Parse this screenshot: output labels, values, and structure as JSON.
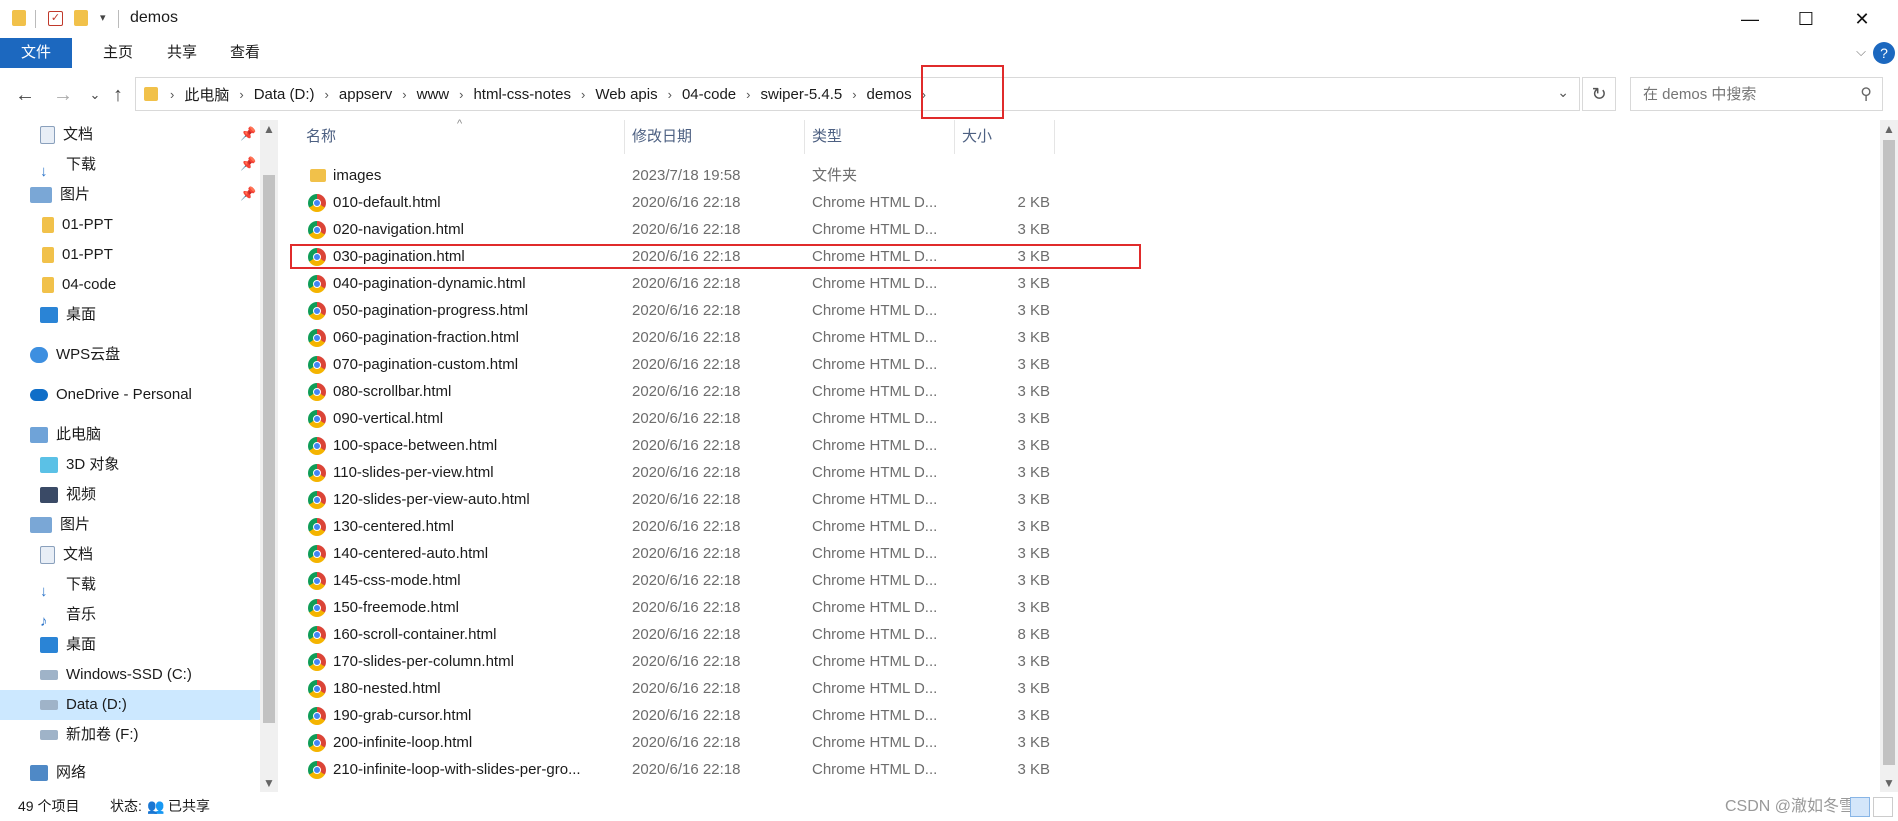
{
  "window": {
    "title": "demos"
  },
  "ribbon": {
    "tabs": [
      "文件",
      "主页",
      "共享",
      "查看"
    ]
  },
  "address": {
    "crumbs": [
      "此电脑",
      "Data (D:)",
      "appserv",
      "www",
      "html-css-notes",
      "Web apis",
      "04-code",
      "swiper-5.4.5",
      "demos"
    ]
  },
  "search": {
    "placeholder": "在 demos 中搜索"
  },
  "nav": {
    "items": [
      {
        "label": "文档",
        "icon": "document-icon",
        "pinned": true
      },
      {
        "label": "下载",
        "icon": "download-icon",
        "pinned": true
      },
      {
        "label": "图片",
        "icon": "pictures-icon",
        "pinned": true
      },
      {
        "label": "01-PPT",
        "icon": "folder-icon"
      },
      {
        "label": "01-PPT",
        "icon": "folder-icon"
      },
      {
        "label": "04-code",
        "icon": "folder-icon"
      },
      {
        "label": "桌面",
        "icon": "desktop-icon"
      },
      {
        "label": "WPS云盘",
        "icon": "cloud-icon"
      },
      {
        "label": "OneDrive - Personal",
        "icon": "onedrive-icon"
      },
      {
        "label": "此电脑",
        "icon": "computer-icon"
      },
      {
        "label": "3D 对象",
        "icon": "3d-objects-icon"
      },
      {
        "label": "视频",
        "icon": "video-icon"
      },
      {
        "label": "图片",
        "icon": "pictures-icon"
      },
      {
        "label": "文档",
        "icon": "document-icon"
      },
      {
        "label": "下载",
        "icon": "download-icon"
      },
      {
        "label": "音乐",
        "icon": "music-icon"
      },
      {
        "label": "桌面",
        "icon": "desktop-icon"
      },
      {
        "label": "Windows-SSD (C:)",
        "icon": "drive-icon"
      },
      {
        "label": "Data (D:)",
        "icon": "drive-icon",
        "selected": true
      },
      {
        "label": "新加卷 (F:)",
        "icon": "drive-icon"
      },
      {
        "label": "网络",
        "icon": "network-icon"
      }
    ]
  },
  "columns": {
    "name": "名称",
    "date": "修改日期",
    "type": "类型",
    "size": "大小"
  },
  "files": [
    {
      "name": "images",
      "date": "2023/7/18 19:58",
      "type": "文件夹",
      "size": "",
      "kind": "folder"
    },
    {
      "name": "010-default.html",
      "date": "2020/6/16 22:18",
      "type": "Chrome HTML D...",
      "size": "2 KB",
      "kind": "chrome"
    },
    {
      "name": "020-navigation.html",
      "date": "2020/6/16 22:18",
      "type": "Chrome HTML D...",
      "size": "3 KB",
      "kind": "chrome"
    },
    {
      "name": "030-pagination.html",
      "date": "2020/6/16 22:18",
      "type": "Chrome HTML D...",
      "size": "3 KB",
      "kind": "chrome",
      "highlighted": true
    },
    {
      "name": "040-pagination-dynamic.html",
      "date": "2020/6/16 22:18",
      "type": "Chrome HTML D...",
      "size": "3 KB",
      "kind": "chrome"
    },
    {
      "name": "050-pagination-progress.html",
      "date": "2020/6/16 22:18",
      "type": "Chrome HTML D...",
      "size": "3 KB",
      "kind": "chrome"
    },
    {
      "name": "060-pagination-fraction.html",
      "date": "2020/6/16 22:18",
      "type": "Chrome HTML D...",
      "size": "3 KB",
      "kind": "chrome"
    },
    {
      "name": "070-pagination-custom.html",
      "date": "2020/6/16 22:18",
      "type": "Chrome HTML D...",
      "size": "3 KB",
      "kind": "chrome"
    },
    {
      "name": "080-scrollbar.html",
      "date": "2020/6/16 22:18",
      "type": "Chrome HTML D...",
      "size": "3 KB",
      "kind": "chrome"
    },
    {
      "name": "090-vertical.html",
      "date": "2020/6/16 22:18",
      "type": "Chrome HTML D...",
      "size": "3 KB",
      "kind": "chrome"
    },
    {
      "name": "100-space-between.html",
      "date": "2020/6/16 22:18",
      "type": "Chrome HTML D...",
      "size": "3 KB",
      "kind": "chrome"
    },
    {
      "name": "110-slides-per-view.html",
      "date": "2020/6/16 22:18",
      "type": "Chrome HTML D...",
      "size": "3 KB",
      "kind": "chrome"
    },
    {
      "name": "120-slides-per-view-auto.html",
      "date": "2020/6/16 22:18",
      "type": "Chrome HTML D...",
      "size": "3 KB",
      "kind": "chrome"
    },
    {
      "name": "130-centered.html",
      "date": "2020/6/16 22:18",
      "type": "Chrome HTML D...",
      "size": "3 KB",
      "kind": "chrome"
    },
    {
      "name": "140-centered-auto.html",
      "date": "2020/6/16 22:18",
      "type": "Chrome HTML D...",
      "size": "3 KB",
      "kind": "chrome"
    },
    {
      "name": "145-css-mode.html",
      "date": "2020/6/16 22:18",
      "type": "Chrome HTML D...",
      "size": "3 KB",
      "kind": "chrome"
    },
    {
      "name": "150-freemode.html",
      "date": "2020/6/16 22:18",
      "type": "Chrome HTML D...",
      "size": "3 KB",
      "kind": "chrome"
    },
    {
      "name": "160-scroll-container.html",
      "date": "2020/6/16 22:18",
      "type": "Chrome HTML D...",
      "size": "8 KB",
      "kind": "chrome"
    },
    {
      "name": "170-slides-per-column.html",
      "date": "2020/6/16 22:18",
      "type": "Chrome HTML D...",
      "size": "3 KB",
      "kind": "chrome"
    },
    {
      "name": "180-nested.html",
      "date": "2020/6/16 22:18",
      "type": "Chrome HTML D...",
      "size": "3 KB",
      "kind": "chrome"
    },
    {
      "name": "190-grab-cursor.html",
      "date": "2020/6/16 22:18",
      "type": "Chrome HTML D...",
      "size": "3 KB",
      "kind": "chrome"
    },
    {
      "name": "200-infinite-loop.html",
      "date": "2020/6/16 22:18",
      "type": "Chrome HTML D...",
      "size": "3 KB",
      "kind": "chrome"
    },
    {
      "name": "210-infinite-loop-with-slides-per-gro...",
      "date": "2020/6/16 22:18",
      "type": "Chrome HTML D...",
      "size": "3 KB",
      "kind": "chrome"
    }
  ],
  "status": {
    "count": "49 个项目",
    "state_label": "状态:",
    "state_value": "已共享"
  },
  "watermark": "CSDN @澈如冬雪",
  "colors": {
    "accent": "#1c68bf",
    "highlight_box": "#e02b2b",
    "folder": "#f1c14a"
  }
}
